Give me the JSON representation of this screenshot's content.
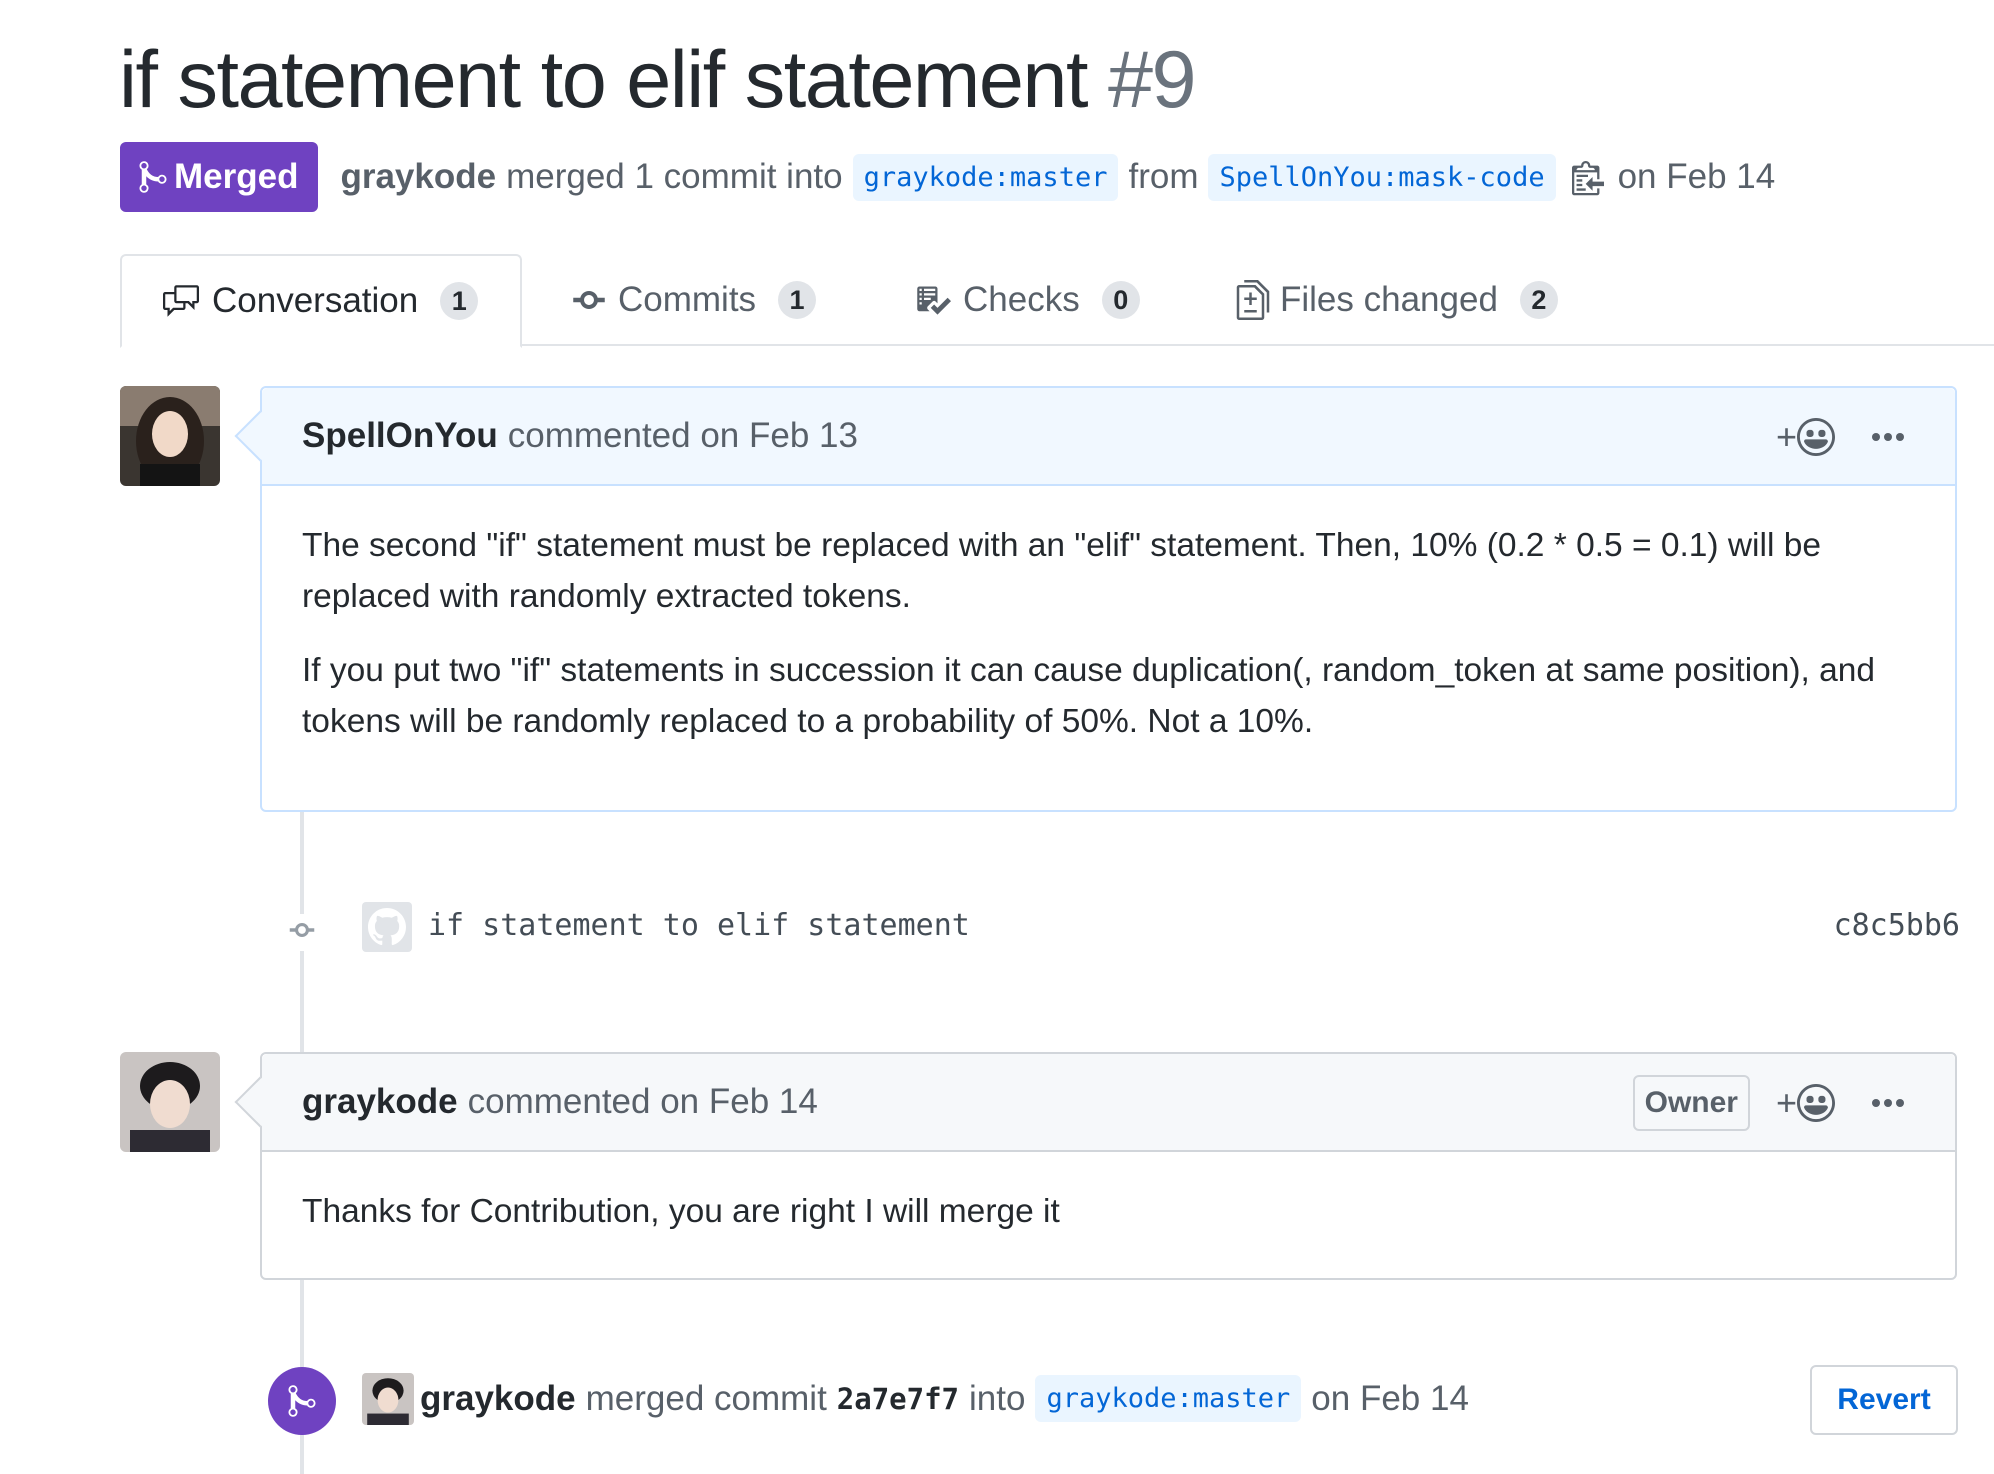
{
  "pr": {
    "title": "if statement to elif statement",
    "number": "#9",
    "state": "Merged",
    "author": "graykode",
    "merged_text": "merged 1 commit into",
    "base_branch": "graykode:master",
    "from_text": "from",
    "head_branch": "SpellOnYou:mask-code",
    "date_text": "on Feb 14"
  },
  "tabs": [
    {
      "label": "Conversation",
      "count": "1"
    },
    {
      "label": "Commits",
      "count": "1"
    },
    {
      "label": "Checks",
      "count": "0"
    },
    {
      "label": "Files changed",
      "count": "2"
    }
  ],
  "comments": [
    {
      "author": "SpellOnYou",
      "meta": "commented on Feb 13",
      "paragraphs": [
        "The second \"if\" statement must be replaced with an \"elif\" statement. Then, 10% (0.2 * 0.5 = 0.1) will be replaced with randomly extracted tokens.",
        "If you put two \"if\" statements in succession it can cause duplication(, random_token at same position), and tokens will be randomly replaced to a probability of 50%. Not a 10%."
      ]
    },
    {
      "author": "graykode",
      "meta": "commented on Feb 14",
      "badge": "Owner",
      "paragraphs": [
        "Thanks for Contribution, you are right I will merge it"
      ]
    }
  ],
  "commit": {
    "message": "if statement to elif statement",
    "sha": "c8c5bb6"
  },
  "merge_event": {
    "author": "graykode",
    "text1": "merged commit",
    "sha": "2a7e7f7",
    "text2": "into",
    "branch": "graykode:master",
    "date": "on Feb 14",
    "revert_label": "Revert"
  },
  "reaction_plus": "+",
  "colors": {
    "merged": "#6f42c1",
    "link": "#0366d6",
    "branch_bg": "#eaf5ff",
    "header_blue": "#f1f8ff"
  }
}
